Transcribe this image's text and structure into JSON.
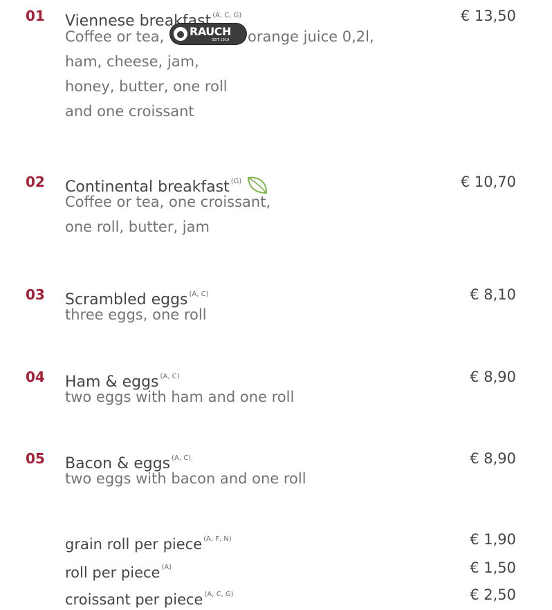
{
  "items": [
    {
      "number": "01",
      "title": "Viennese breakfast",
      "allergens": "(A, C, G)",
      "price": "€ 13,50",
      "desc": [
        "Coffee or tea,",
        "orange juice 0,2l,",
        "ham, cheese, jam,",
        "honey, butter, one roll",
        "and one croissant"
      ]
    },
    {
      "number": "02",
      "title": "Continental breakfast",
      "allergens": "(G)",
      "price": "€ 10,70",
      "icon": "leaf-icon",
      "desc": [
        "Coffee or tea, one croissant,",
        "one roll, butter, jam"
      ]
    },
    {
      "number": "03",
      "title": "Scrambled eggs",
      "allergens": "(A, C)",
      "price": "€ 8,10",
      "desc": [
        "three eggs, one roll"
      ]
    },
    {
      "number": "04",
      "title": "Ham & eggs",
      "allergens": "(A, C)",
      "price": "€ 8,90",
      "desc": [
        "two eggs with ham and one roll"
      ]
    },
    {
      "number": "05",
      "title": "Bacon & eggs",
      "allergens": "(A, C)",
      "price": "€ 8,90",
      "desc": [
        "two eggs with bacon and one roll"
      ]
    }
  ],
  "extras": [
    {
      "title": "grain roll per piece",
      "allergens": "(A, F, N)",
      "price": "€ 1,90"
    },
    {
      "title": "roll per piece",
      "allergens": "(A)",
      "price": "€ 1,50"
    },
    {
      "title": "croissant per piece",
      "allergens": "(A, C, G)",
      "price": "€ 2,50"
    }
  ],
  "brand_logo": {
    "name": "RAUCH",
    "tagline": "SEIT 1919"
  },
  "colors": {
    "number": "#a51f36",
    "text": "#454545",
    "desc": "#737373",
    "leaf": "#7db54a"
  }
}
